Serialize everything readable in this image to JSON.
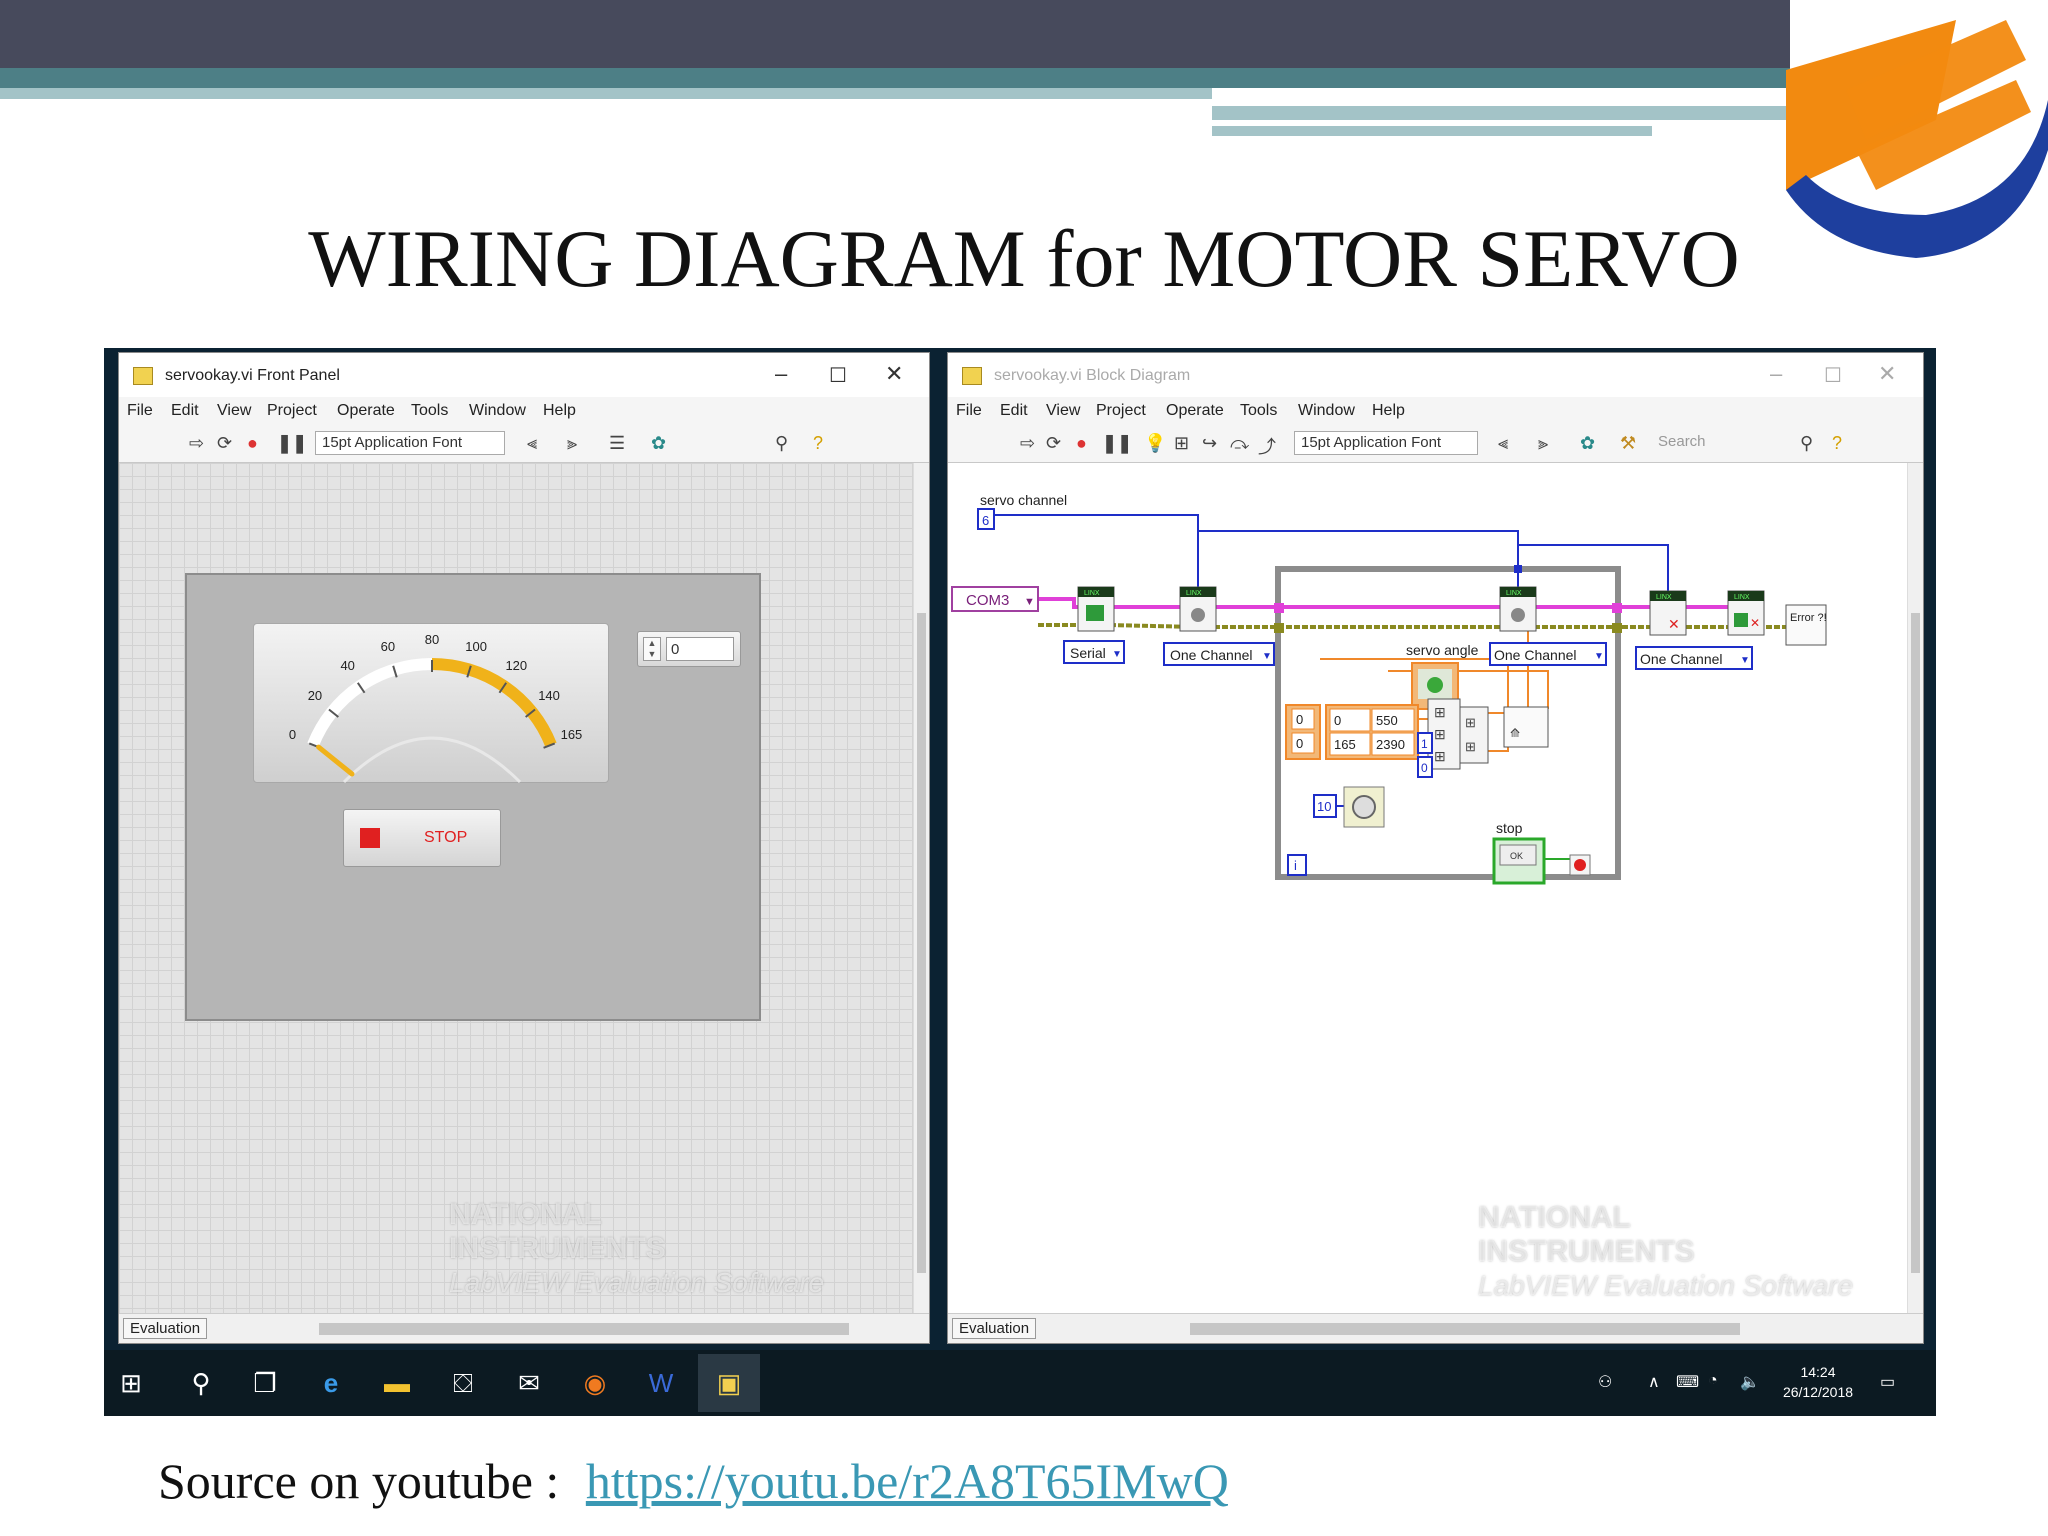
{
  "slide": {
    "title": "WIRING DIAGRAM for MOTOR SERVO",
    "source_label": "Source on youtube :",
    "source_link": "https://youtu.be/r2A8T65IMwQ"
  },
  "front_panel": {
    "window_title": "servookay.vi Front Panel",
    "menu": [
      "File",
      "Edit",
      "View",
      "Project",
      "Operate",
      "Tools",
      "Window",
      "Help"
    ],
    "font_selector": "15pt Application Font",
    "gauge_ticks": [
      "0",
      "20",
      "40",
      "60",
      "80",
      "100",
      "120",
      "140",
      "165"
    ],
    "numeric_value": "0",
    "stop_label": "STOP",
    "status": "Evaluation",
    "watermark_lines": [
      "NATIONAL",
      "INSTRUMENTS",
      "LabVIEW Evaluation Software"
    ]
  },
  "block_diagram": {
    "window_title": "servookay.vi Block Diagram",
    "menu": [
      "File",
      "Edit",
      "View",
      "Project",
      "Operate",
      "Tools",
      "Window",
      "Help"
    ],
    "font_selector": "15pt Application Font",
    "search_placeholder": "Search",
    "labels": {
      "servo_channel": "servo channel",
      "channel_const": "6",
      "com_port": "COM3",
      "serial": "Serial",
      "one_channel_1": "One Channel",
      "servo_angle": "servo angle",
      "one_channel_2": "One Channel",
      "one_channel_3": "One Channel",
      "stop": "stop",
      "wait_const": "10",
      "loop_index": "i",
      "ok_label": "OK",
      "error_label": "Error ?!"
    },
    "scale_table": [
      [
        "0",
        "550"
      ],
      [
        "165",
        "2390"
      ]
    ],
    "left_consts": [
      "0",
      "0"
    ],
    "index_consts": [
      "1",
      "0"
    ],
    "status": "Evaluation",
    "watermark_lines": [
      "NATIONAL",
      "INSTRUMENTS",
      "LabVIEW Evaluation Software"
    ]
  },
  "taskbar": {
    "time": "14:24",
    "date": "26/12/2018"
  },
  "colors": {
    "header_dark": "#474a5c",
    "header_teal": "#4d7f86",
    "logo_orange": "#f28a10",
    "logo_blue": "#1e3f9e",
    "link": "#3a98b4",
    "gauge_yellow": "#f0b21a",
    "wire_pink": "#e040d8",
    "wire_olive": "#8a8a20",
    "wire_blue": "#1e2ec8",
    "wire_orange": "#f0882a"
  }
}
